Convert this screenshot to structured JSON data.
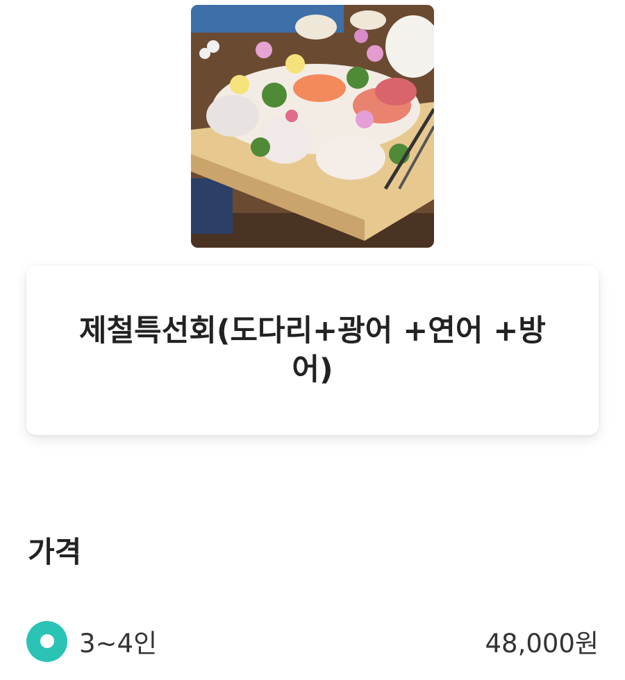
{
  "menu_item": {
    "photo_icon": "sashimi-platter-image",
    "title": "제철특선회(도다리+광어 +연어 +방어)"
  },
  "price_section": {
    "heading": "가격",
    "options": [
      {
        "label": "3~4인",
        "price": "48,000원",
        "selected": true
      }
    ]
  },
  "colors": {
    "accent": "#2bc3b5",
    "text": "#222222"
  }
}
